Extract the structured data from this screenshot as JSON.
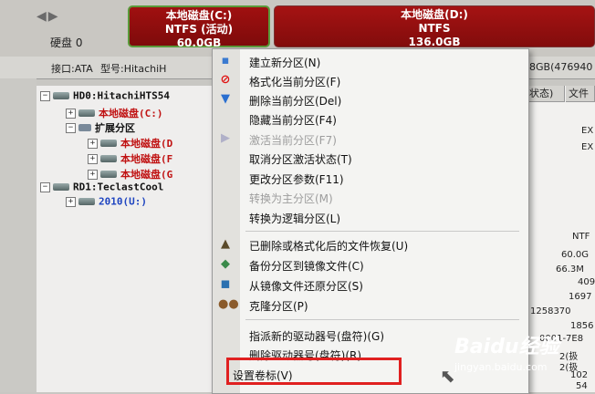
{
  "header": {
    "nav_arrows": "◀▶",
    "disk_label": "硬盘 0"
  },
  "partitions": [
    {
      "name": "本地磁盘(C:)",
      "fs": "NTFS (活动)",
      "size": "60.0GB"
    },
    {
      "name": "本地磁盘(D:)",
      "fs": "NTFS",
      "size": "136.0GB"
    }
  ],
  "infobar": {
    "interface_label": "接口:ATA",
    "model_label": "型号:HitachiH",
    "right_text": "8GB(476940"
  },
  "tree": {
    "items": [
      {
        "label": "HD0:HitachiHTS54"
      },
      {
        "label": "本地磁盘(C:)"
      },
      {
        "label": "扩展分区"
      },
      {
        "label": "本地磁盘(D"
      },
      {
        "label": "本地磁盘(F"
      },
      {
        "label": "本地磁盘(G"
      },
      {
        "label": "RD1:TeclastCool"
      },
      {
        "label": "2010(U:)"
      }
    ]
  },
  "right_panel": {
    "headers": [
      "状态)",
      "文件"
    ],
    "cells": [
      "EX",
      "EX",
      "NTF",
      "60.0G",
      "66.3M",
      "409",
      "1697",
      "1258370",
      "1856",
      "0001-7E8",
      "2(扱",
      "2(扱",
      "102",
      "54"
    ]
  },
  "context_menu": {
    "items": [
      {
        "label": "建立新分区(N)",
        "icon": "new-partition-icon"
      },
      {
        "label": "格式化当前分区(F)",
        "icon": "format-icon"
      },
      {
        "label": "删除当前分区(Del)",
        "icon": "delete-icon"
      },
      {
        "label": "隐藏当前分区(F4)",
        "icon": ""
      },
      {
        "label": "激活当前分区(F7)",
        "icon": "activate-icon"
      },
      {
        "label": "取消分区激活状态(T)",
        "icon": ""
      },
      {
        "label": "更改分区参数(F11)",
        "icon": ""
      },
      {
        "label": "转换为主分区(M)",
        "icon": ""
      },
      {
        "label": "转换为逻辑分区(L)",
        "icon": ""
      },
      {
        "label": "已删除或格式化后的文件恢复(U)",
        "icon": "recover-icon"
      },
      {
        "label": "备份分区到镜像文件(C)",
        "icon": "backup-icon"
      },
      {
        "label": "从镜像文件还原分区(S)",
        "icon": "restore-icon"
      },
      {
        "label": "克隆分区(P)",
        "icon": "clone-icon"
      },
      {
        "label": "指派新的驱动器号(盘符)(G)",
        "icon": ""
      },
      {
        "label": "删除驱动器号(盘符)(R)",
        "icon": ""
      },
      {
        "label": "设置卷标(V)",
        "icon": ""
      }
    ]
  },
  "watermark": {
    "logo": "Baidu经验",
    "url": "jingyan.baidu.com"
  }
}
